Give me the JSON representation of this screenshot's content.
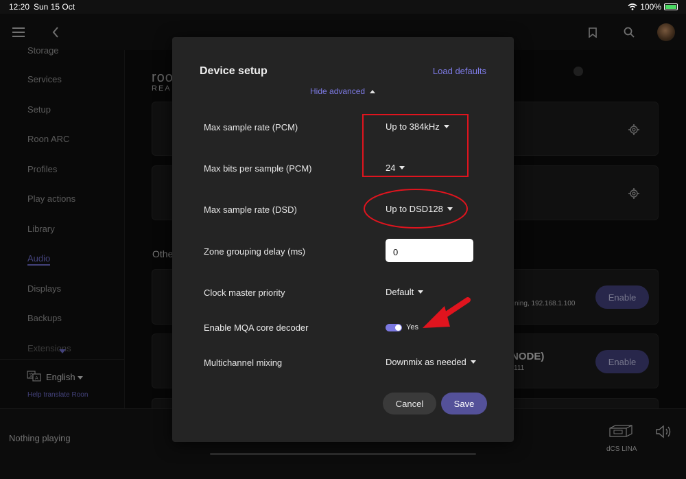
{
  "status_bar": {
    "time": "12:20",
    "date": "Sun 15 Oct",
    "battery": "100%"
  },
  "sidebar": {
    "items": [
      {
        "label": "Storage"
      },
      {
        "label": "Services"
      },
      {
        "label": "Setup"
      },
      {
        "label": "Roon ARC"
      },
      {
        "label": "Profiles"
      },
      {
        "label": "Play actions"
      },
      {
        "label": "Library"
      },
      {
        "label": "Audio"
      },
      {
        "label": "Displays"
      },
      {
        "label": "Backups"
      },
      {
        "label": "Extensions"
      }
    ],
    "language": "English",
    "translate_link": "Help translate Roon"
  },
  "background": {
    "brand_top": "roo",
    "brand_bottom": "REA",
    "other_heading": "Othe",
    "card1_detail": "ning, 192.168.1.100",
    "card2_title": "NODE)",
    "card2_detail": "111",
    "enable_label": "Enable"
  },
  "bottom_bar": {
    "now_playing": "Nothing playing",
    "zone_name": "dCS LINA"
  },
  "modal": {
    "title": "Device setup",
    "load_defaults": "Load defaults",
    "hide_advanced": "Hide advanced",
    "rows": {
      "max_pcm_rate": {
        "label": "Max sample rate (PCM)",
        "value": "Up to 384kHz"
      },
      "max_bits": {
        "label": "Max bits per sample (PCM)",
        "value": "24"
      },
      "max_dsd_rate": {
        "label": "Max sample rate (DSD)",
        "value": "Up to DSD128"
      },
      "grouping_delay": {
        "label": "Zone grouping delay (ms)",
        "value": "0"
      },
      "clock_priority": {
        "label": "Clock master priority",
        "value": "Default"
      },
      "mqa_decoder": {
        "label": "Enable MQA core decoder",
        "value": "Yes",
        "enabled": true
      },
      "multichannel": {
        "label": "Multichannel mixing",
        "value": "Downmix as needed"
      }
    },
    "cancel_label": "Cancel",
    "save_label": "Save"
  },
  "colors": {
    "accent": "#7b78e0",
    "save_button": "#545199",
    "annotation_red": "#e0141e"
  },
  "icons": [
    "menu-icon",
    "back-icon",
    "bookmark-icon",
    "search-icon",
    "avatar",
    "gear-icon",
    "translate-icon",
    "device-icon",
    "volume-icon",
    "wifi-icon",
    "battery-icon"
  ]
}
